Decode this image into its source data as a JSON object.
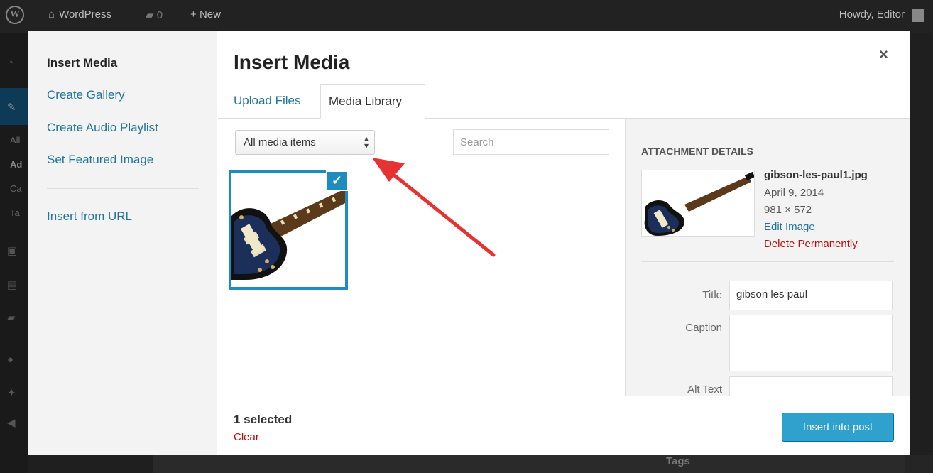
{
  "adminbar": {
    "site_name": "WordPress",
    "comments_count": "0",
    "new_label": "New",
    "howdy": "Howdy, Editor"
  },
  "adminmenu": {
    "sub_items": [
      "All",
      "Ad",
      "Ca",
      "Ta"
    ]
  },
  "background": {
    "tags_label": "Tags"
  },
  "modal": {
    "title": "Insert Media",
    "close_label": "×",
    "menu": {
      "insert_media": "Insert Media",
      "create_gallery": "Create Gallery",
      "create_audio_playlist": "Create Audio Playlist",
      "set_featured_image": "Set Featured Image",
      "insert_from_url": "Insert from URL"
    },
    "tabs": {
      "upload": "Upload Files",
      "library": "Media Library"
    },
    "toolbar": {
      "filter_value": "All media items",
      "search_placeholder": "Search"
    },
    "attachment": {
      "check": "✓"
    },
    "details": {
      "header": "Attachment Details",
      "filename": "gibson-les-paul1.jpg",
      "date": "April 9, 2014",
      "dimensions": "981 × 572",
      "edit_image": "Edit Image",
      "delete_permanently": "Delete Permanently",
      "title_label": "Title",
      "title_value": "gibson les paul",
      "caption_label": "Caption",
      "alt_label": "Alt Text"
    },
    "footer": {
      "selected": "1 selected",
      "clear": "Clear",
      "insert_button": "Insert into post"
    }
  },
  "colors": {
    "link": "#21759b",
    "selected": "#1e8cbe",
    "primary_button": "#2ea2cc",
    "delete": "#bc0b0b",
    "annotation": "#e63232"
  }
}
